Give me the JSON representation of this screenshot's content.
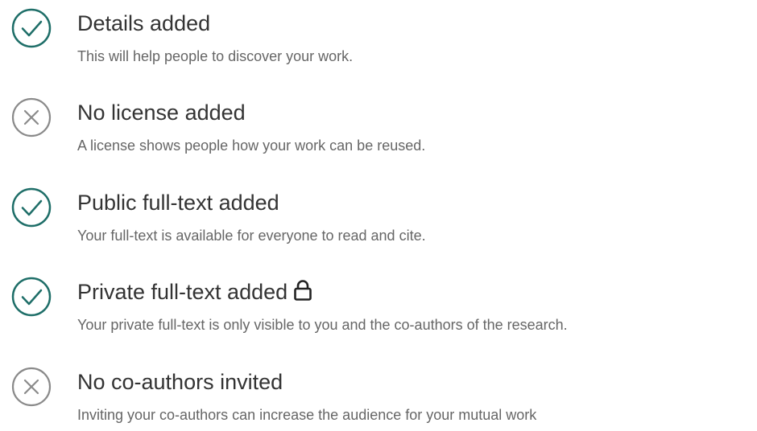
{
  "colors": {
    "success": "#1e6e68",
    "neutral": "#8a8a8a",
    "title_text": "#333333",
    "desc_text": "#666666"
  },
  "checklist": {
    "items": [
      {
        "status": "done",
        "icon": "check-circle-icon",
        "title": "Details added",
        "description": "This will help people to discover your work."
      },
      {
        "status": "missing",
        "icon": "x-circle-icon",
        "title": "No license added",
        "description": "A license shows people how your work can be reused."
      },
      {
        "status": "done",
        "icon": "check-circle-icon",
        "title": "Public full-text added",
        "description": "Your full-text is available for everyone to read and cite."
      },
      {
        "status": "done",
        "icon": "check-circle-icon",
        "title": "Private full-text added",
        "title_icon": "lock-icon",
        "description": "Your private full-text is only visible to you and the co-authors of the research."
      },
      {
        "status": "missing",
        "icon": "x-circle-icon",
        "title": "No co-authors invited",
        "description": "Inviting your co-authors can increase the audience for your mutual work"
      }
    ]
  }
}
